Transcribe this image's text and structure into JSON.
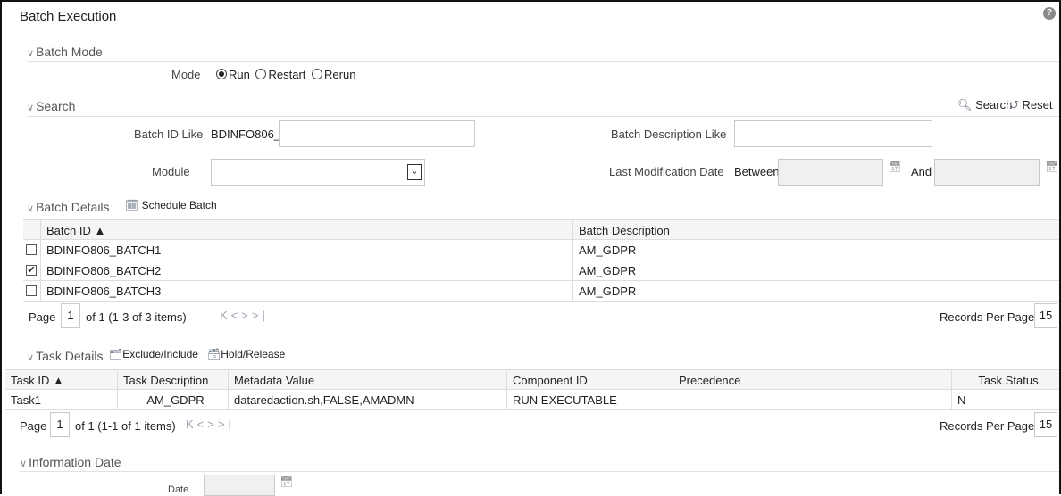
{
  "page": {
    "title": "Batch Execution",
    "help_icon": "?"
  },
  "batch_mode": {
    "section_label": "Batch Mode",
    "mode_label": "Mode",
    "options": [
      {
        "label": "Run",
        "selected": true
      },
      {
        "label": "Restart",
        "selected": false
      },
      {
        "label": "Rerun",
        "selected": false
      }
    ]
  },
  "search": {
    "section_label": "Search",
    "search_button": "Search",
    "reset_button": "Reset",
    "batch_id_label": "Batch ID Like",
    "batch_id_value": "BDINFO806_",
    "batch_desc_label": "Batch Description Like",
    "batch_desc_value": "",
    "module_label": "Module",
    "module_value": "",
    "last_mod_label": "Last Modification Date",
    "between_label": "Between",
    "and_label": "And"
  },
  "batch_details": {
    "section_label": "Batch Details",
    "schedule_button": "Schedule Batch",
    "columns": [
      "Batch ID ▲",
      "Batch Description"
    ],
    "rows": [
      {
        "id": "BDINFO806_BATCH1",
        "desc": "AM_GDPR",
        "checked": false
      },
      {
        "id": "BDINFO806_BATCH2",
        "desc": "AM_GDPR",
        "checked": true
      },
      {
        "id": "BDINFO806_BATCH3",
        "desc": "AM_GDPR",
        "checked": false
      }
    ],
    "pager": {
      "page_label": "Page",
      "page": "1",
      "summary": "of 1 (1-3 of 3 items)",
      "records_label": "Records Per Page",
      "records": "15"
    }
  },
  "task_details": {
    "section_label": "Task Details",
    "exclude_button": "Exclude/Include",
    "hold_button": "Hold/Release",
    "columns": [
      "Task ID ▲",
      "Task Description",
      "Metadata Value",
      "Component ID",
      "Precedence",
      "Task Status"
    ],
    "rows": [
      {
        "task_id": "Task1",
        "desc": "AM_GDPR",
        "metadata": "dataredaction.sh,FALSE,AMADMN",
        "component": "RUN EXECUTABLE",
        "precedence": "",
        "status": "N"
      }
    ],
    "pager": {
      "page_label": "Page",
      "page": "1",
      "summary": "of 1 (1-1 of 1 items)",
      "records_label": "Records Per Page",
      "records": "15"
    }
  },
  "information_date": {
    "section_label": "Information Date",
    "date_label": "Date"
  },
  "colors": {
    "accent": "#6b7685",
    "border": "#c9c9c9",
    "header_bg": "#f5f5f5"
  }
}
